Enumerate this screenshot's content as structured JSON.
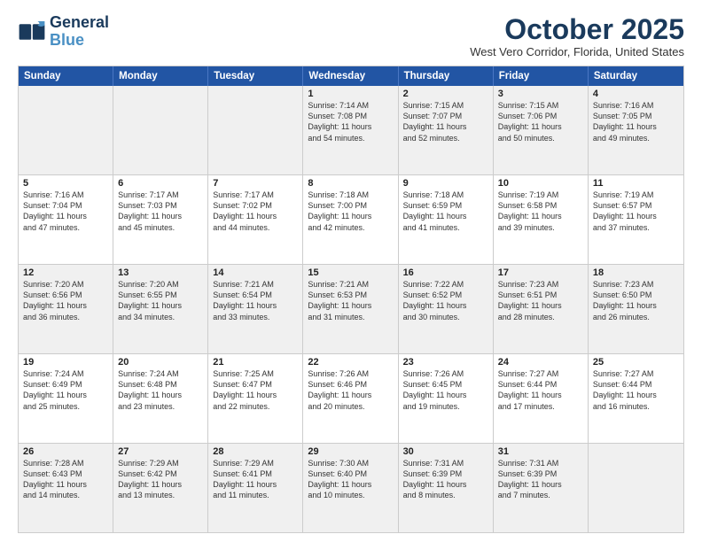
{
  "logo": {
    "line1": "General",
    "line2": "Blue"
  },
  "title": "October 2025",
  "location": "West Vero Corridor, Florida, United States",
  "weekdays": [
    "Sunday",
    "Monday",
    "Tuesday",
    "Wednesday",
    "Thursday",
    "Friday",
    "Saturday"
  ],
  "rows": [
    [
      {
        "day": "",
        "text": ""
      },
      {
        "day": "",
        "text": ""
      },
      {
        "day": "",
        "text": ""
      },
      {
        "day": "1",
        "text": "Sunrise: 7:14 AM\nSunset: 7:08 PM\nDaylight: 11 hours\nand 54 minutes."
      },
      {
        "day": "2",
        "text": "Sunrise: 7:15 AM\nSunset: 7:07 PM\nDaylight: 11 hours\nand 52 minutes."
      },
      {
        "day": "3",
        "text": "Sunrise: 7:15 AM\nSunset: 7:06 PM\nDaylight: 11 hours\nand 50 minutes."
      },
      {
        "day": "4",
        "text": "Sunrise: 7:16 AM\nSunset: 7:05 PM\nDaylight: 11 hours\nand 49 minutes."
      }
    ],
    [
      {
        "day": "5",
        "text": "Sunrise: 7:16 AM\nSunset: 7:04 PM\nDaylight: 11 hours\nand 47 minutes."
      },
      {
        "day": "6",
        "text": "Sunrise: 7:17 AM\nSunset: 7:03 PM\nDaylight: 11 hours\nand 45 minutes."
      },
      {
        "day": "7",
        "text": "Sunrise: 7:17 AM\nSunset: 7:02 PM\nDaylight: 11 hours\nand 44 minutes."
      },
      {
        "day": "8",
        "text": "Sunrise: 7:18 AM\nSunset: 7:00 PM\nDaylight: 11 hours\nand 42 minutes."
      },
      {
        "day": "9",
        "text": "Sunrise: 7:18 AM\nSunset: 6:59 PM\nDaylight: 11 hours\nand 41 minutes."
      },
      {
        "day": "10",
        "text": "Sunrise: 7:19 AM\nSunset: 6:58 PM\nDaylight: 11 hours\nand 39 minutes."
      },
      {
        "day": "11",
        "text": "Sunrise: 7:19 AM\nSunset: 6:57 PM\nDaylight: 11 hours\nand 37 minutes."
      }
    ],
    [
      {
        "day": "12",
        "text": "Sunrise: 7:20 AM\nSunset: 6:56 PM\nDaylight: 11 hours\nand 36 minutes."
      },
      {
        "day": "13",
        "text": "Sunrise: 7:20 AM\nSunset: 6:55 PM\nDaylight: 11 hours\nand 34 minutes."
      },
      {
        "day": "14",
        "text": "Sunrise: 7:21 AM\nSunset: 6:54 PM\nDaylight: 11 hours\nand 33 minutes."
      },
      {
        "day": "15",
        "text": "Sunrise: 7:21 AM\nSunset: 6:53 PM\nDaylight: 11 hours\nand 31 minutes."
      },
      {
        "day": "16",
        "text": "Sunrise: 7:22 AM\nSunset: 6:52 PM\nDaylight: 11 hours\nand 30 minutes."
      },
      {
        "day": "17",
        "text": "Sunrise: 7:23 AM\nSunset: 6:51 PM\nDaylight: 11 hours\nand 28 minutes."
      },
      {
        "day": "18",
        "text": "Sunrise: 7:23 AM\nSunset: 6:50 PM\nDaylight: 11 hours\nand 26 minutes."
      }
    ],
    [
      {
        "day": "19",
        "text": "Sunrise: 7:24 AM\nSunset: 6:49 PM\nDaylight: 11 hours\nand 25 minutes."
      },
      {
        "day": "20",
        "text": "Sunrise: 7:24 AM\nSunset: 6:48 PM\nDaylight: 11 hours\nand 23 minutes."
      },
      {
        "day": "21",
        "text": "Sunrise: 7:25 AM\nSunset: 6:47 PM\nDaylight: 11 hours\nand 22 minutes."
      },
      {
        "day": "22",
        "text": "Sunrise: 7:26 AM\nSunset: 6:46 PM\nDaylight: 11 hours\nand 20 minutes."
      },
      {
        "day": "23",
        "text": "Sunrise: 7:26 AM\nSunset: 6:45 PM\nDaylight: 11 hours\nand 19 minutes."
      },
      {
        "day": "24",
        "text": "Sunrise: 7:27 AM\nSunset: 6:44 PM\nDaylight: 11 hours\nand 17 minutes."
      },
      {
        "day": "25",
        "text": "Sunrise: 7:27 AM\nSunset: 6:44 PM\nDaylight: 11 hours\nand 16 minutes."
      }
    ],
    [
      {
        "day": "26",
        "text": "Sunrise: 7:28 AM\nSunset: 6:43 PM\nDaylight: 11 hours\nand 14 minutes."
      },
      {
        "day": "27",
        "text": "Sunrise: 7:29 AM\nSunset: 6:42 PM\nDaylight: 11 hours\nand 13 minutes."
      },
      {
        "day": "28",
        "text": "Sunrise: 7:29 AM\nSunset: 6:41 PM\nDaylight: 11 hours\nand 11 minutes."
      },
      {
        "day": "29",
        "text": "Sunrise: 7:30 AM\nSunset: 6:40 PM\nDaylight: 11 hours\nand 10 minutes."
      },
      {
        "day": "30",
        "text": "Sunrise: 7:31 AM\nSunset: 6:39 PM\nDaylight: 11 hours\nand 8 minutes."
      },
      {
        "day": "31",
        "text": "Sunrise: 7:31 AM\nSunset: 6:39 PM\nDaylight: 11 hours\nand 7 minutes."
      },
      {
        "day": "",
        "text": ""
      }
    ]
  ]
}
